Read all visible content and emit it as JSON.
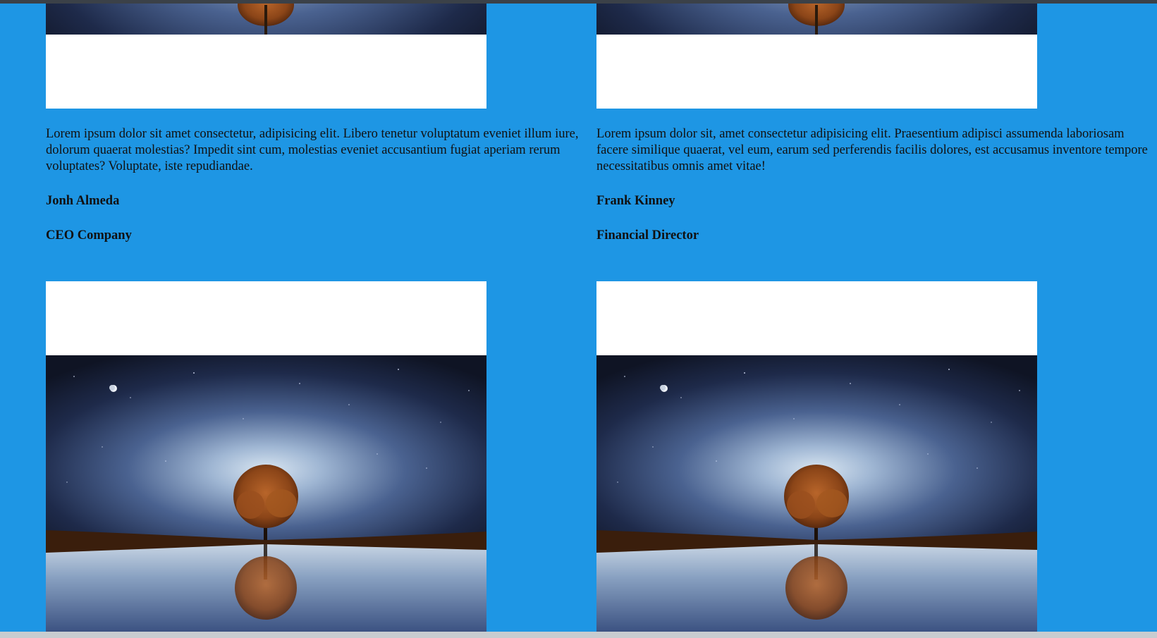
{
  "testimonials_top": [
    {
      "quote": "Lorem ipsum dolor sit amet consectetur, adipisicing elit. Libero tenetur voluptatum eveniet illum iure, dolorum quaerat molestias? Impedit sint cum, molestias eveniet accusantium fugiat aperiam rerum voluptates? Voluptate, iste repudiandae.",
      "name": "Jonh Almeda",
      "role": "CEO Company"
    },
    {
      "quote": "Lorem ipsum dolor sit, amet consectetur adipisicing elit. Praesentium adipisci assumenda laboriosam facere similique quaerat, vel eum, earum sed perferendis facilis dolores, est accusamus inventore tempore necessitatibus omnis amet vitae!",
      "name": "Frank Kinney",
      "role": "Financial Director"
    }
  ],
  "colors": {
    "background": "#1e96e4",
    "card_white": "#ffffff",
    "text": "#111111"
  },
  "icons": [
    "night-tree-photo"
  ]
}
